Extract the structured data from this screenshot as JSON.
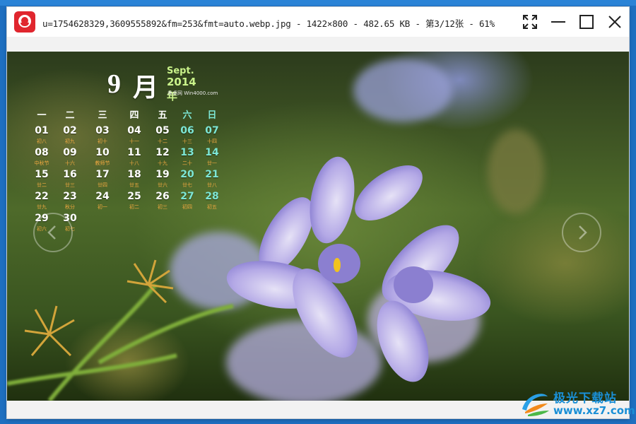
{
  "window": {
    "title": "u=1754628329,3609555892&fm=253&fmt=auto.webp.jpg - 1422×800 - 482.65 KB - 第3/12张 - 61%"
  },
  "calendar": {
    "month_num": "9",
    "month_zh": "月",
    "month_en": "Sept.",
    "year": "2014年",
    "site": "美桌网 Win4000.com",
    "weekdays": [
      "一",
      "二",
      "三",
      "四",
      "五",
      "六",
      "日"
    ],
    "weeks": [
      [
        [
          "01",
          "初八"
        ],
        [
          "02",
          "初九"
        ],
        [
          "03",
          "初十"
        ],
        [
          "04",
          "十一"
        ],
        [
          "05",
          "十二"
        ],
        [
          "06",
          "十三"
        ],
        [
          "07",
          "十四"
        ]
      ],
      [
        [
          "08",
          "中秋节"
        ],
        [
          "09",
          "十六"
        ],
        [
          "10",
          "教师节"
        ],
        [
          "11",
          "十八"
        ],
        [
          "12",
          "十九"
        ],
        [
          "13",
          "二十"
        ],
        [
          "14",
          "廿一"
        ]
      ],
      [
        [
          "15",
          "廿二"
        ],
        [
          "16",
          "廿三"
        ],
        [
          "17",
          "廿四"
        ],
        [
          "18",
          "廿五"
        ],
        [
          "19",
          "廿六"
        ],
        [
          "20",
          "廿七"
        ],
        [
          "21",
          "廿八"
        ]
      ],
      [
        [
          "22",
          "廿九"
        ],
        [
          "23",
          "秋分"
        ],
        [
          "24",
          "初一"
        ],
        [
          "25",
          "初二"
        ],
        [
          "26",
          "初三"
        ],
        [
          "27",
          "初四"
        ],
        [
          "28",
          "初五"
        ]
      ],
      [
        [
          "29",
          "初六"
        ],
        [
          "30",
          "初七"
        ]
      ]
    ]
  },
  "watermark": {
    "name": "极光下载站",
    "url": "www.xz7.com"
  },
  "icons": {
    "app": "photo-viewer-app-icon",
    "fullscreen": "fullscreen-icon",
    "minimize": "minimize-icon",
    "maximize": "maximize-icon",
    "close": "close-icon",
    "prev": "chevron-left-icon",
    "next": "chevron-right-icon"
  },
  "colors": {
    "desktop": "#1e6fc0",
    "app_icon": "#e0262e",
    "weekend": "#7de7d6",
    "lunar": "#f0a840",
    "watermark": "#1a8fd6"
  }
}
